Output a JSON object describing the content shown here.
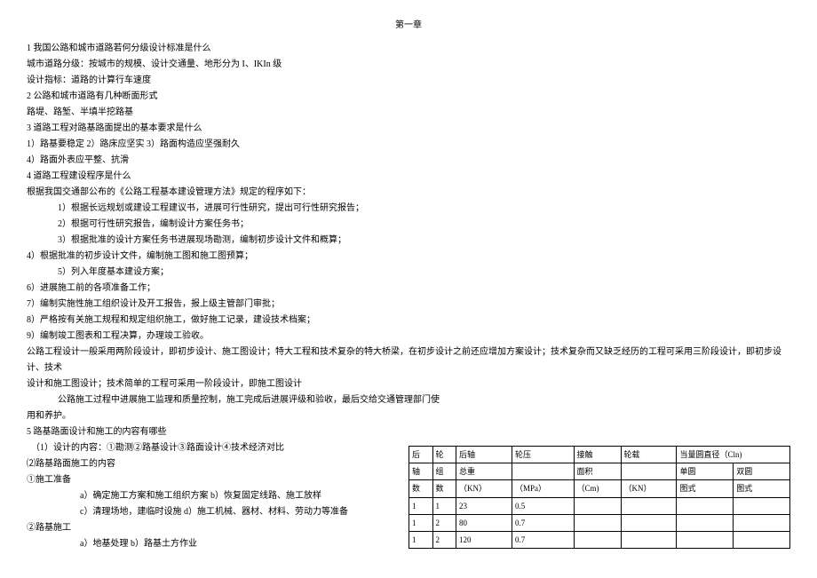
{
  "title": "第一章",
  "lines": {
    "l1": "1 我国公路和城市道路若何分级设计标准是什么",
    "l2": "城市道路分级：按城市的规模、设计交通量、地形分为 I、IKIn 级",
    "l3": "设计指标：道路的计算行车速度",
    "l4": "2 公路和城市道路有几种断面形式",
    "l5": "路堤、路堑、半填半挖路基",
    "l6": "3 道路工程对路基路面提出的基本要求是什么",
    "l7": "1）路基要稳定 2）路床应坚实 3）路面构造应坚强耐久",
    "l8": "4）路面外表应平整、抗滑",
    "l9": "4 道路工程建设程序是什么",
    "l10": "根据我国交通部公布的《公路工程基本建设管理方法》规定的程序如下：",
    "l11": "1）根据长远规划或建设工程建议书，进展可行性研究，提出可行性研究报告；",
    "l12": "2）根据可行性研究报告，编制设计方案任务书；",
    "l13": "3）根据批准的设计方案任务书进展现场勘测，编制初步设计文件和概算；",
    "l14": "4）根据批准的初步设计文件，编制施工图和施工图预算；",
    "l15": "5）列入年度基本建设方案；",
    "l16": "6）进展施工前的各项准备工作；",
    "l17": "7）编制实施性施工组织设计及开工报告，报上级主管部门审批；",
    "l18": "8）严格按有关施工规程和规定组织施工，做好施工记录，建设技术档案；",
    "l19": "9）编制竣工图表和工程决算，办理竣工验收。",
    "l20": "公路工程设计一般采用两阶段设计，即初步设计、施工图设计；特大工程和技术复杂的特大桥梁，在初步设计之前还应增加方案设计；技术复杂而又缺乏经历的工程可采用三阶段设计，即初步设计、技术",
    "l21": "设计和施工图设计；技术简单的工程可采用一阶段设计，即施工图设计",
    "l22": "公路施工过程中进展施工监理和质量控制，施工完成后进展评级和验收，最后交给交通管理部门使",
    "l23": "用和养护。",
    "l24": "5 路基路面设计和施工的内容有哪些",
    "l25": "（1）设计的内容：①勘测②路基设计③路面设计④技术经济对比",
    "l26": "⑵路基路面施工的内容",
    "l27": "①施工准备",
    "l28": "a）确定施工方案和施工组织方案 b）恢复固定线路、施工放样",
    "l29": "c）清理场地，建临时设施 d）施工机械、器材、材料、劳动力等准备",
    "l30": "②路基施工",
    "l31": "a）地基处理 b）路基土方作业"
  },
  "table": {
    "header": {
      "r1c1": "后",
      "r1c2": "轮",
      "r1c3": "后轴",
      "r1c4": "轮压",
      "r1c5": "接触",
      "r1c6": "轮载",
      "r1c7": "当量圆直径（Cln)",
      "r2c1": "轴",
      "r2c2": "组",
      "r2c3": "总重",
      "r2c4": "",
      "r2c5": "面积",
      "r2c6": "",
      "r2c7": "单圆",
      "r2c8": "双圆",
      "r3c1": "数",
      "r3c2": "数",
      "r3c3": "（KN）",
      "r3c4": "（MPa）",
      "r3c5": "（Cm)",
      "r3c6": "（KN）",
      "r3c7": "图式",
      "r3c8": "图式"
    },
    "rows": [
      {
        "c1": "1",
        "c2": "1",
        "c3": "23",
        "c4": "0.5",
        "c5": "",
        "c6": "",
        "c7": "",
        "c8": ""
      },
      {
        "c1": "1",
        "c2": "2",
        "c3": "80",
        "c4": "0.7",
        "c5": "",
        "c6": "",
        "c7": "",
        "c8": ""
      },
      {
        "c1": "1",
        "c2": "2",
        "c3": "120",
        "c4": "0.7",
        "c5": "",
        "c6": "",
        "c7": "",
        "c8": ""
      }
    ]
  }
}
